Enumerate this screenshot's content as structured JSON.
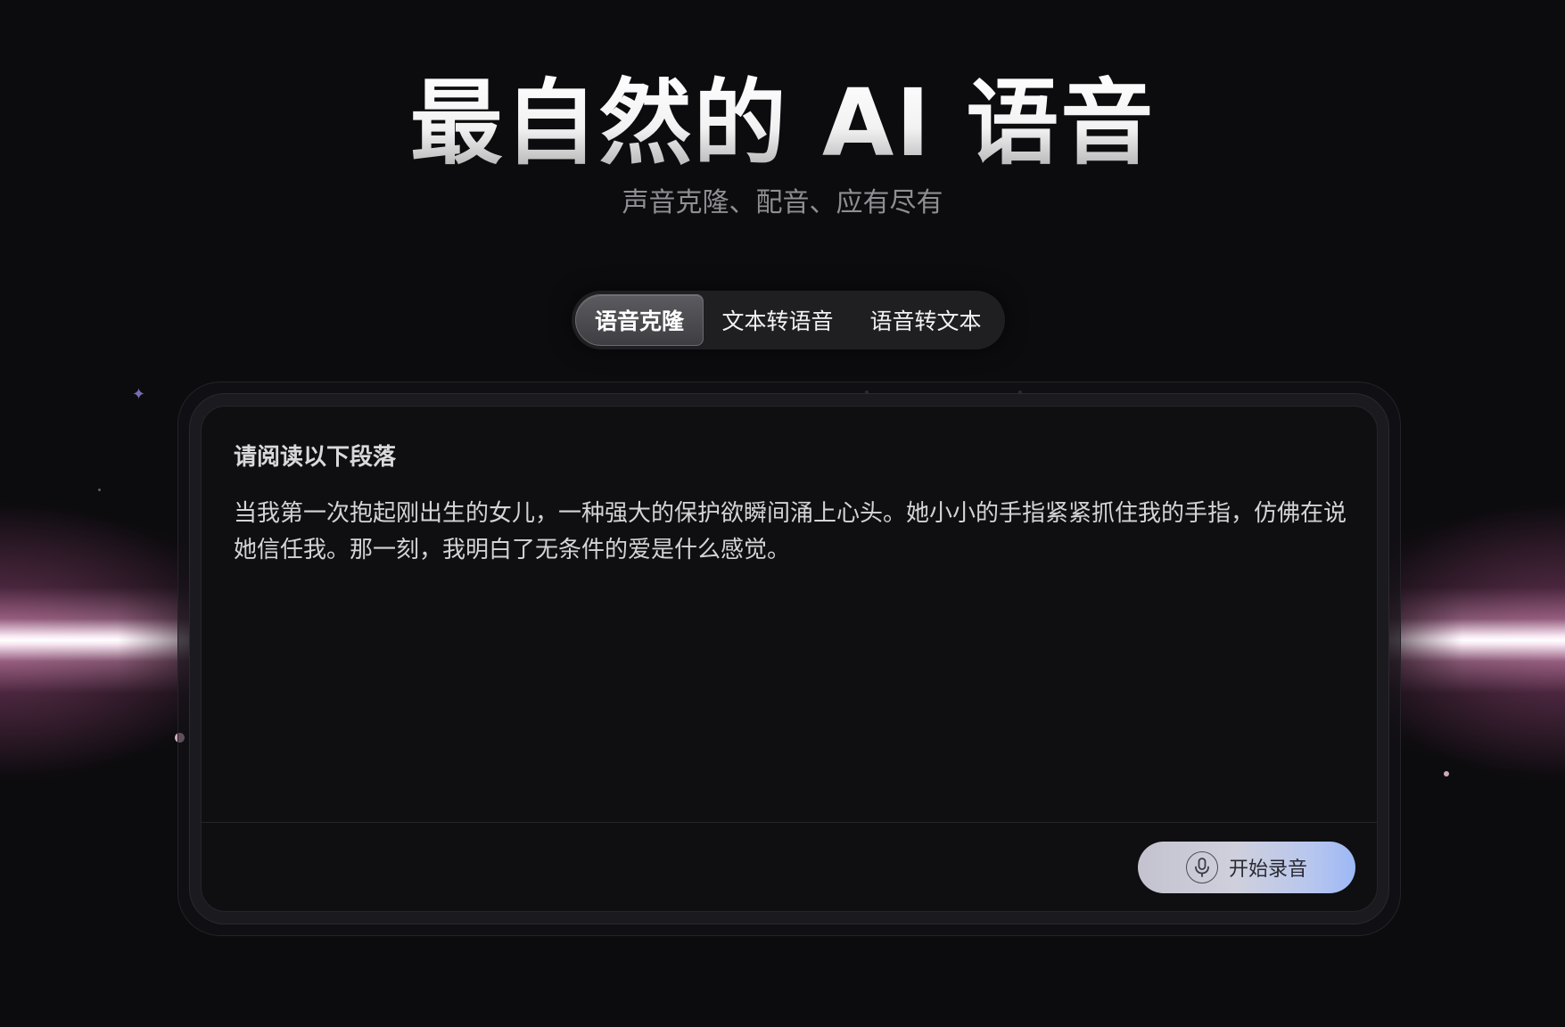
{
  "hero": {
    "title": "最自然的 AI 语音",
    "subtitle": "声音克隆、配音、应有尽有"
  },
  "tabs": [
    {
      "label": "语音克隆",
      "active": true
    },
    {
      "label": "文本转语音",
      "active": false
    },
    {
      "label": "语音转文本",
      "active": false
    }
  ],
  "card": {
    "heading": "请阅读以下段落",
    "passage": "当我第一次抱起刚出生的女儿，一种强大的保护欲瞬间涌上心头。她小小的手指紧紧抓住我的手指，仿佛在说她信任我。那一刻，我明白了无条件的爱是什么感觉。",
    "record_button": {
      "label": "开始录音",
      "icon": "microphone-icon"
    }
  },
  "colors": {
    "background": "#0c0b0e",
    "card_background": "#0f0f12",
    "beam_glow": "#ffb4dc",
    "button_gradient_start": "#c4c2cf",
    "button_gradient_end": "#9cb8f5"
  }
}
